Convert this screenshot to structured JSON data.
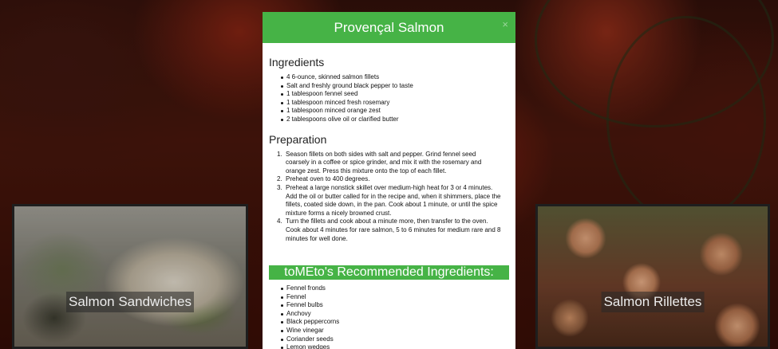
{
  "modal": {
    "title": "Provençal Salmon",
    "close_label": "×",
    "ingredients_heading": "Ingredients",
    "ingredients": [
      "4 6-ounce, skinned salmon fillets",
      "Salt and freshly ground black pepper to taste",
      "1 tablespoon fennel seed",
      "1 tablespoon minced fresh rosemary",
      "1 tablespoon minced orange zest",
      "2 tablespoons olive oil or clarified butter"
    ],
    "preparation_heading": "Preparation",
    "steps": [
      "Season fillets on both sides with salt and pepper. Grind fennel seed coarsely in a coffee or spice grinder, and mix it with the rosemary and orange zest. Press this mixture onto the top of each fillet.",
      "Preheat oven to 400 degrees.",
      "Preheat a large nonstick skillet over medium-high heat for 3 or 4 minutes. Add the oil or butter called for in the recipe and, when it shimmers, place the fillets, coated side down, in the pan. Cook about 1 minute, or until the spice mixture forms a nicely browned crust.",
      "Turn the fillets and cook about a minute more, then transfer to the oven. Cook about 4 minutes for rare salmon, 5 to 6 minutes for medium rare and 8 minutes for well done."
    ],
    "recommended_heading": "toMEto's Recommended Ingredients:",
    "recommended": [
      "Fennel fronds",
      "Fennel",
      "Fennel bulbs",
      "Anchovy",
      "Black peppercorns",
      "Wine vinegar",
      "Coriander seeds",
      "Lemon wedges"
    ]
  },
  "cards": [
    {
      "label": "Salmon Sandwiches"
    },
    {
      "label": "Salmon Rillettes"
    }
  ],
  "colors": {
    "accent": "#46b346"
  }
}
